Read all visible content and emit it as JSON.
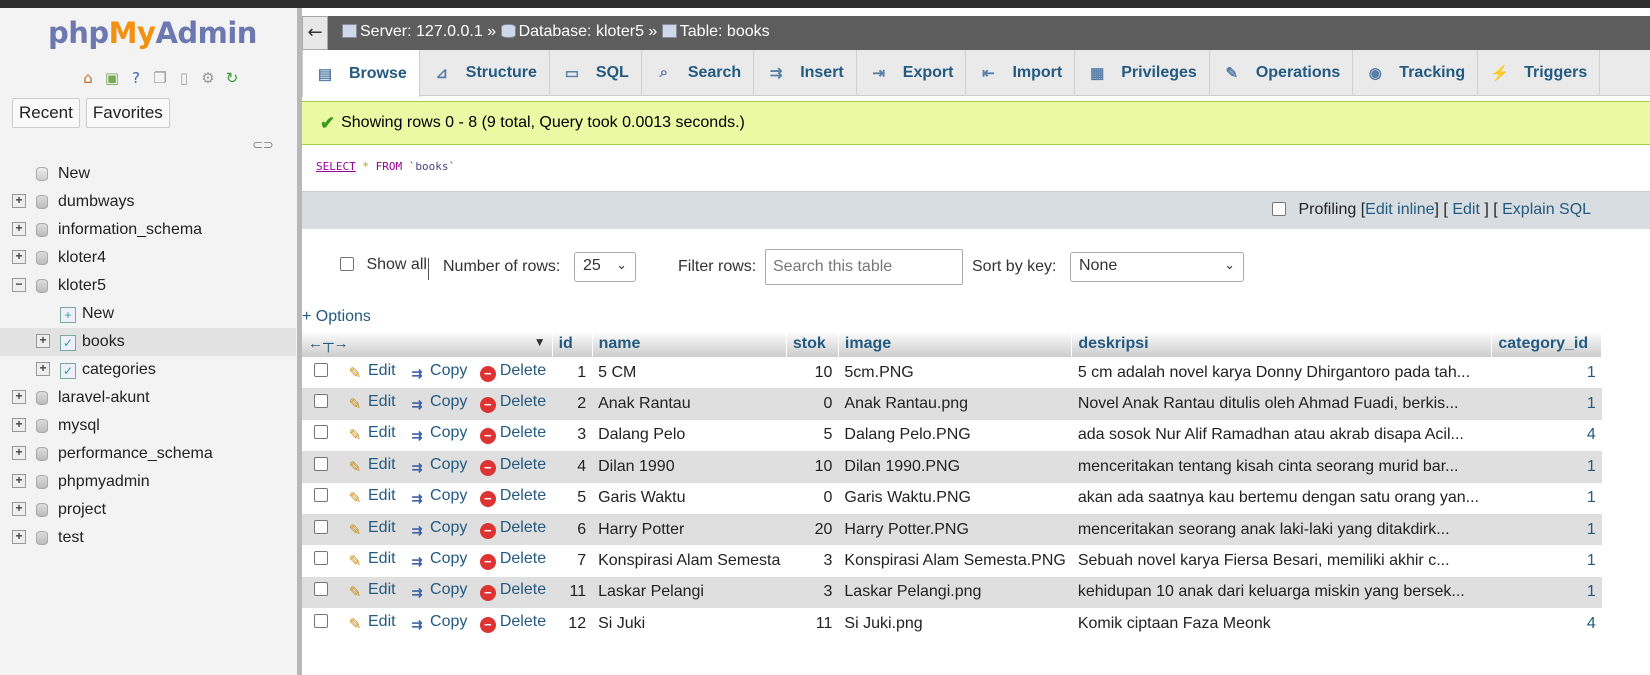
{
  "logo": {
    "php": "php",
    "my": "My",
    "admin": "Admin"
  },
  "left": {
    "recent_label": "Recent",
    "favorites_label": "Favorites",
    "tree": [
      {
        "label": "New",
        "level": 0,
        "expander": "none",
        "icon": "new-db-icon"
      },
      {
        "label": "dumbways",
        "level": 0,
        "expander": "plus",
        "icon": "database-icon"
      },
      {
        "label": "information_schema",
        "level": 0,
        "expander": "plus",
        "icon": "database-icon"
      },
      {
        "label": "kloter4",
        "level": 0,
        "expander": "plus",
        "icon": "database-icon"
      },
      {
        "label": "kloter5",
        "level": 0,
        "expander": "minus",
        "icon": "database-icon"
      },
      {
        "label": "New",
        "level": 1,
        "expander": "none",
        "icon": "new-table-icon"
      },
      {
        "label": "books",
        "level": 1,
        "expander": "plus",
        "icon": "table-icon",
        "selected": true
      },
      {
        "label": "categories",
        "level": 1,
        "expander": "plus",
        "icon": "table-icon"
      },
      {
        "label": "laravel-akunt",
        "level": 0,
        "expander": "plus",
        "icon": "database-icon"
      },
      {
        "label": "mysql",
        "level": 0,
        "expander": "plus",
        "icon": "database-icon"
      },
      {
        "label": "performance_schema",
        "level": 0,
        "expander": "plus",
        "icon": "database-icon"
      },
      {
        "label": "phpmyadmin",
        "level": 0,
        "expander": "plus",
        "icon": "database-icon"
      },
      {
        "label": "project",
        "level": 0,
        "expander": "plus",
        "icon": "database-icon"
      },
      {
        "label": "test",
        "level": 0,
        "expander": "plus",
        "icon": "database-icon"
      }
    ]
  },
  "breadcrumb": {
    "server": "Server: 127.0.0.1",
    "sep": "»",
    "database": "Database: kloter5",
    "table": "Table: books"
  },
  "tabs": [
    {
      "label": "Browse",
      "icon": "browse-icon",
      "active": true
    },
    {
      "label": "Structure",
      "icon": "structure-icon"
    },
    {
      "label": "SQL",
      "icon": "sql-icon"
    },
    {
      "label": "Search",
      "icon": "search-icon"
    },
    {
      "label": "Insert",
      "icon": "insert-icon"
    },
    {
      "label": "Export",
      "icon": "export-icon"
    },
    {
      "label": "Import",
      "icon": "import-icon"
    },
    {
      "label": "Privileges",
      "icon": "privileges-icon"
    },
    {
      "label": "Operations",
      "icon": "operations-icon"
    },
    {
      "label": "Tracking",
      "icon": "tracking-icon"
    },
    {
      "label": "Triggers",
      "icon": "triggers-icon"
    }
  ],
  "message": "Showing rows 0 - 8 (9 total, Query took 0.0013 seconds.)",
  "sql": {
    "select": "SELECT",
    "star": "*",
    "from": "FROM",
    "table": "`books`"
  },
  "profiling": {
    "label": "Profiling",
    "edit_inline": "Edit inline",
    "edit": "Edit",
    "explain": "Explain SQL"
  },
  "controls": {
    "show_all": "Show all",
    "number_of_rows": "Number of rows:",
    "rows_value": "25",
    "filter_rows": "Filter rows:",
    "filter_placeholder": "Search this table",
    "sort_by_key": "Sort by key:",
    "sort_value": "None"
  },
  "options_label": "+ Options",
  "table": {
    "headers": {
      "id": "id",
      "name": "name",
      "stok": "stok",
      "image": "image",
      "deskripsi": "deskripsi",
      "category_id": "category_id"
    },
    "action_labels": {
      "edit": "Edit",
      "copy": "Copy",
      "delete": "Delete"
    },
    "rows": [
      {
        "id": "1",
        "name": "5 CM",
        "stok": "10",
        "image": "5cm.PNG",
        "deskripsi": "5 cm adalah novel karya Donny Dhirgantoro pada tah...",
        "category_id": "1"
      },
      {
        "id": "2",
        "name": "Anak Rantau",
        "stok": "0",
        "image": "Anak Rantau.png",
        "deskripsi": "Novel Anak Rantau ditulis oleh Ahmad Fuadi, berkis...",
        "category_id": "1"
      },
      {
        "id": "3",
        "name": "Dalang Pelo",
        "stok": "5",
        "image": "Dalang Pelo.PNG",
        "deskripsi": "ada sosok Nur Alif Ramadhan atau akrab disapa Acil...",
        "category_id": "4"
      },
      {
        "id": "4",
        "name": "Dilan 1990",
        "stok": "10",
        "image": "Dilan 1990.PNG",
        "deskripsi": "menceritakan tentang kisah cinta seorang murid bar...",
        "category_id": "1"
      },
      {
        "id": "5",
        "name": "Garis Waktu",
        "stok": "0",
        "image": "Garis Waktu.PNG",
        "deskripsi": "akan ada saatnya kau bertemu dengan satu orang yan...",
        "category_id": "1"
      },
      {
        "id": "6",
        "name": "Harry Potter",
        "stok": "20",
        "image": "Harry Potter.PNG",
        "deskripsi": "menceritakan seorang anak laki-laki yang ditakdirk...",
        "category_id": "1"
      },
      {
        "id": "7",
        "name": "Konspirasi Alam Semesta",
        "stok": "3",
        "image": "Konspirasi Alam Semesta.PNG",
        "deskripsi": "Sebuah novel karya Fiersa Besari, memiliki akhir c...",
        "category_id": "1"
      },
      {
        "id": "11",
        "name": "Laskar Pelangi",
        "stok": "3",
        "image": "Laskar Pelangi.png",
        "deskripsi": "kehidupan 10 anak dari keluarga miskin yang bersek...",
        "category_id": "1"
      },
      {
        "id": "12",
        "name": "Si Juki",
        "stok": "11",
        "image": "Si Juki.png",
        "deskripsi": "Komik ciptaan Faza Meonk",
        "category_id": "4"
      }
    ]
  }
}
